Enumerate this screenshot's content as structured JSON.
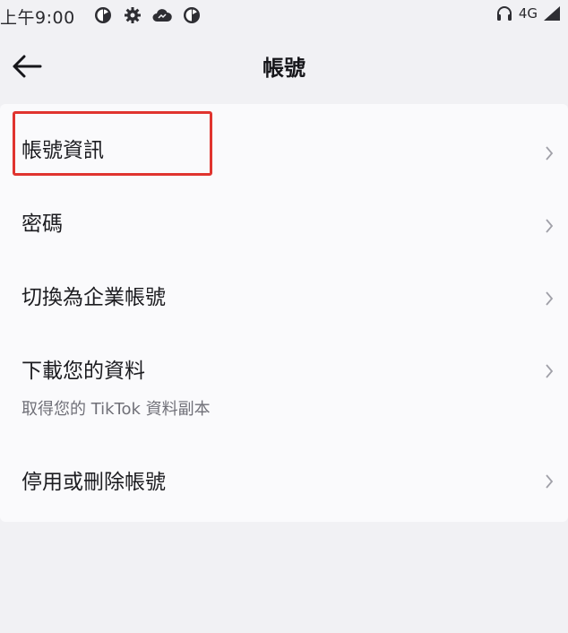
{
  "status_bar": {
    "time": "上午9:00",
    "network": "4G",
    "left_icons": [
      "data-saver-icon",
      "settings-gear-icon",
      "cloud-icon",
      "data-saver-icon"
    ],
    "right_icons": [
      "headphones-icon",
      "signal-icon"
    ]
  },
  "header": {
    "title": "帳號",
    "back_icon": "arrow-left-icon"
  },
  "menu": {
    "items": [
      {
        "label": "帳號資訊",
        "subtitle": ""
      },
      {
        "label": "密碼",
        "subtitle": ""
      },
      {
        "label": "切換為企業帳號",
        "subtitle": ""
      },
      {
        "label": "下載您的資料",
        "subtitle": "取得您的 TikTok 資料副本"
      },
      {
        "label": "停用或刪除帳號",
        "subtitle": ""
      }
    ],
    "chevron_icon": "chevron-right-icon"
  },
  "annotation": {
    "highlight_color": "#e0342f",
    "highlighted_item": "帳號資訊"
  },
  "colors": {
    "background": "#f1f1f4",
    "card": "#fafafc",
    "text": "#1c1c20",
    "subtext": "#707078"
  }
}
